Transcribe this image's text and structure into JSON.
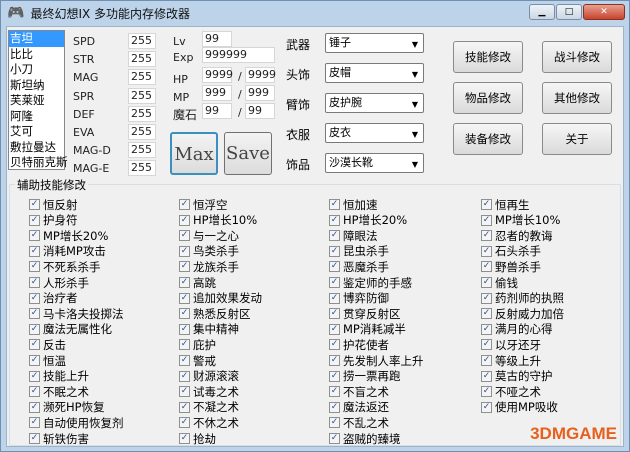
{
  "title": "最终幻想IX 多功能内存修改器",
  "characters": [
    "吉坦",
    "比比",
    "小刀",
    "斯坦纳",
    "芙莱娅",
    "阿隆",
    "艾可",
    "敷拉曼达",
    "贝特丽克斯"
  ],
  "selected_character": "吉坦",
  "stats": [
    {
      "label": "SPD",
      "value": "255"
    },
    {
      "label": "STR",
      "value": "255"
    },
    {
      "label": "MAG",
      "value": "255"
    },
    {
      "label": "SPR",
      "value": "255"
    },
    {
      "label": "DEF",
      "value": "255"
    },
    {
      "label": "EVA",
      "value": "255"
    },
    {
      "label": "MAG-D",
      "value": "255"
    },
    {
      "label": "MAG-E",
      "value": "255"
    }
  ],
  "level": {
    "lv_label": "Lv",
    "lv": "99",
    "exp_label": "Exp",
    "exp": "999999",
    "hp_label": "HP",
    "hp": "9999",
    "hp_max": "9999",
    "mp_label": "MP",
    "mp": "999",
    "mp_max": "999",
    "stone_label": "魔石",
    "stone": "99",
    "stone_max": "99",
    "slash": "/"
  },
  "max_label": "Max",
  "save_label": "Save",
  "equipment": [
    {
      "label": "武器",
      "value": "锤子"
    },
    {
      "label": "头饰",
      "value": "皮帽"
    },
    {
      "label": "臂饰",
      "value": "皮护腕"
    },
    {
      "label": "衣服",
      "value": "皮衣"
    },
    {
      "label": "饰品",
      "value": "沙漠长靴"
    }
  ],
  "buttons": [
    "技能修改",
    "战斗修改",
    "物品修改",
    "其他修改",
    "装备修改",
    "关于"
  ],
  "group_title": "辅助技能修改",
  "skills": [
    [
      "恒反射",
      "护身符",
      "MP增长20%",
      "消耗MP攻击",
      "不死系杀手",
      "人形杀手",
      "治疗者",
      "马卡洛夫投掷法",
      "魔法无属性化",
      "反击",
      "恒温",
      "技能上升",
      "不眠之术",
      "濒死HP恢复",
      "自动使用恢复剂",
      "斩铁伤害"
    ],
    [
      "恒浮空",
      "HP增长10%",
      "与一之心",
      "鸟类杀手",
      "龙族杀手",
      "高跳",
      "追加效果发动",
      "熟悉反射区",
      "集中精神",
      "庇护",
      "警戒",
      "财源滚滚",
      "试毒之术",
      "不凝之术",
      "不休之术",
      "抢劫"
    ],
    [
      "恒加速",
      "HP增长20%",
      "障眼法",
      "昆虫杀手",
      "恶魔杀手",
      "鉴定师的手感",
      "博弈防御",
      "贯穿反射区",
      "MP消耗减半",
      "护花使者",
      "先发制人率上升",
      "捞一票再跑",
      "不盲之术",
      "魔法返还",
      "不乱之术",
      "盗贼的臻境"
    ],
    [
      "恒再生",
      "MP增长10%",
      "忍者的教诲",
      "石头杀手",
      "野兽杀手",
      "偷钱",
      "药剂师的执照",
      "反射威力加倍",
      "满月的心得",
      "以牙还牙",
      "等级上升",
      "莫古的守护",
      "不哑之术",
      "使用MP吸收"
    ]
  ],
  "window_controls": {
    "minimize": "▁",
    "maximize": "□",
    "close": "✕"
  },
  "watermark": "3DMGAME"
}
